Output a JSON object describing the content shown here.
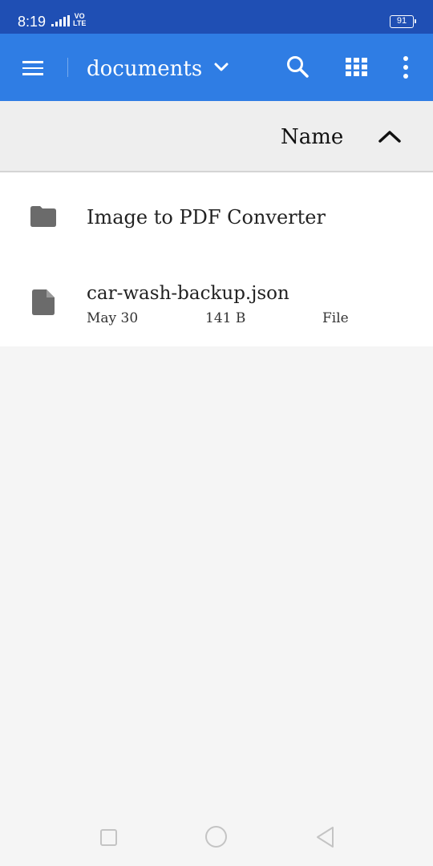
{
  "status_bar": {
    "time": "8:19",
    "network": "VO LTE",
    "network_top": "VO",
    "network_bottom": "LTE",
    "battery": "91",
    "icons": [
      "signal-icon",
      "battery-icon"
    ]
  },
  "app_bar": {
    "title": "documents",
    "icons": [
      "menu-icon",
      "chevron-down-icon",
      "search-icon",
      "grid-view-icon",
      "more-vert-icon"
    ]
  },
  "sort": {
    "label": "Name",
    "icon": "chevron-up-icon"
  },
  "files": [
    {
      "type": "folder",
      "icon": "folder-icon",
      "name": "Image to PDF Converter"
    },
    {
      "type": "file",
      "icon": "file-icon",
      "name": "car-wash-backup.json",
      "date": "May 30",
      "size": "141 B",
      "kind": "File"
    }
  ],
  "nav_bar": {
    "icons": [
      "recents-icon",
      "home-icon",
      "back-icon"
    ]
  },
  "colors": {
    "status_bar": "#1f4fb4",
    "app_bar": "#2f7de4",
    "sort_bar": "#eeeeee",
    "list_bg": "#ffffff",
    "page_bg": "#f5f5f5",
    "icon_gray": "#6b6b6b"
  }
}
